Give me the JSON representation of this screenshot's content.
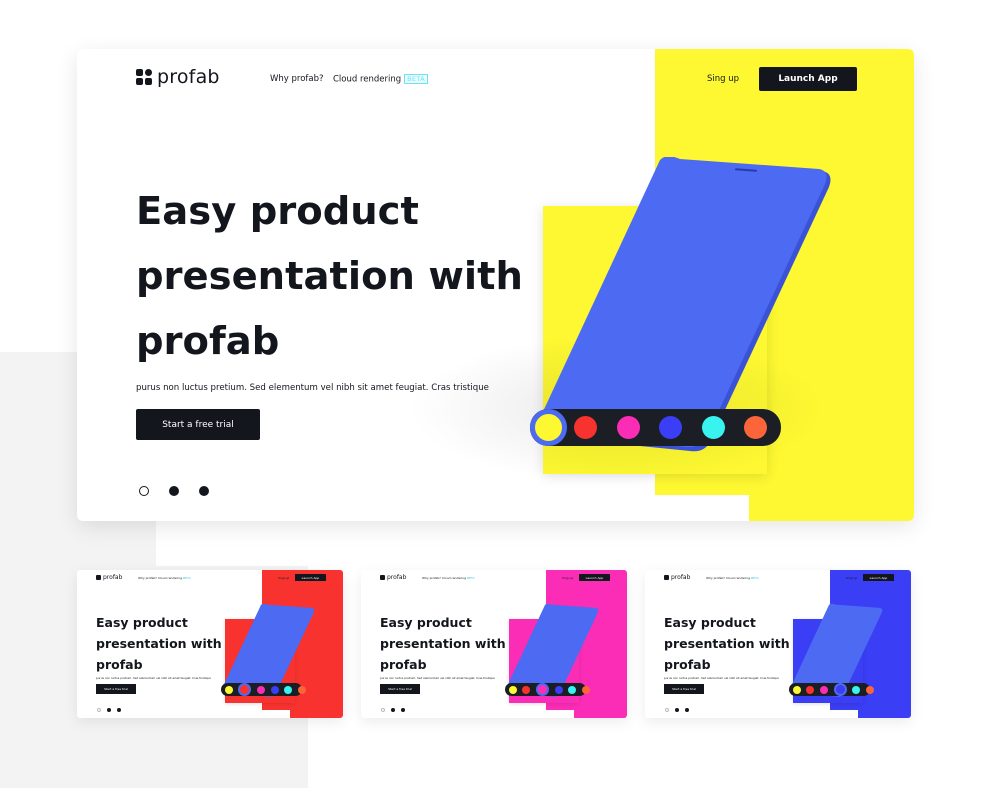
{
  "brand": {
    "name": "profab"
  },
  "nav": {
    "why": "Why profab?",
    "cloud": "Cloud rendering",
    "beta": "BETA",
    "signup": "Sing up",
    "launch": "Launch App"
  },
  "hero": {
    "title_line1": "Easy product",
    "title_line2": "presentation with",
    "title_line3": "profab",
    "subtitle": "purus non luctus pretium. Sed elementum vel nibh sit amet feugiat. Cras tristique",
    "cta": "Start a free trial"
  },
  "slider": {
    "count": 3,
    "active_index": 0
  },
  "colors": {
    "dark": "#13161d",
    "phone": "#4d6af2",
    "main_accent": "#fdf831",
    "swatches": [
      "#fdf831",
      "#f8332f",
      "#fb2db6",
      "#3a3ef4",
      "#38f3f0",
      "#fb6539"
    ]
  },
  "variants": [
    {
      "accent": "#f8332f",
      "selected_swatch": 1
    },
    {
      "accent": "#fb2db6",
      "selected_swatch": 2
    },
    {
      "accent": "#3a3ef4",
      "selected_swatch": 3
    }
  ]
}
